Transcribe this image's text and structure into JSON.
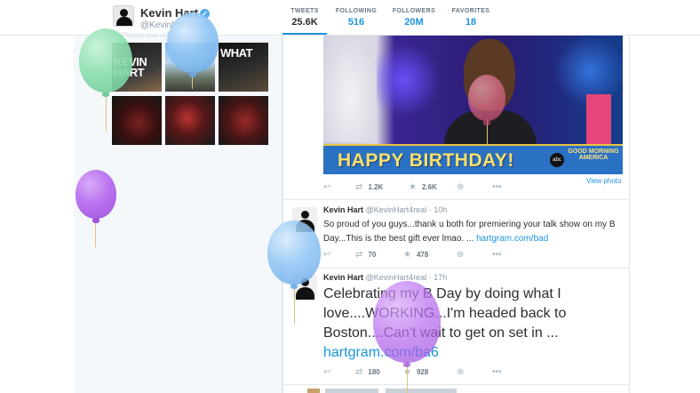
{
  "profile": {
    "name": "Kevin Hart",
    "handle": "@KevinHart4real",
    "verified_icon": "verified-badge-icon",
    "faded_text": "... Photos and videos"
  },
  "stats": [
    {
      "label": "TWEETS",
      "value": "25.6K",
      "active": true
    },
    {
      "label": "FOLLOWING",
      "value": "516",
      "active": false
    },
    {
      "label": "FOLLOWERS",
      "value": "20M",
      "active": false
    },
    {
      "label": "FAVORITES",
      "value": "18",
      "active": false
    }
  ],
  "photo_grid": {
    "thumbs": [
      {
        "text": "KEVIN HART"
      },
      {
        "text": ""
      },
      {
        "text": "WHAT"
      },
      {
        "text": ""
      },
      {
        "text": ""
      },
      {
        "text": ""
      }
    ]
  },
  "tweet1": {
    "media_banner": "HAPPY BIRTHDAY!",
    "media_logo": "abc",
    "media_show": "GOOD MORNING AMERICA",
    "view_photo": "View photo",
    "retweets": "1.2K",
    "favorites": "2.6K"
  },
  "tweet2": {
    "name": "Kevin Hart",
    "handle": "@KevinHart4real",
    "time": "· 10h",
    "text": "So proud of you guys...thank u both for premiering your talk show on my B Day...This is the best gift ever lmao. ... ",
    "link": "hartgram.com/bad",
    "retweets": "70",
    "favorites": "478"
  },
  "tweet3": {
    "name": "Kevin Hart",
    "handle": "@KevinHart4real",
    "time": "· 17h",
    "text": "Celebrating my B Day by doing what I love....WORKING...I'm headed back to Boston....Can't wait to get on set in ... ",
    "link": "hartgram.com/ba6",
    "retweets": "180",
    "favorites": "928"
  },
  "icons": {
    "reply": "reply-icon",
    "retweet": "retweet-icon",
    "favorite": "star-icon",
    "add": "add-user-icon",
    "more": "more-icon"
  },
  "colors": {
    "link": "#1b95e0",
    "balloon_green": "#8ee0b0",
    "balloon_blue": "#8dc4f5",
    "balloon_purple": "#b76df0",
    "balloon_pink": "#e46a8e"
  }
}
